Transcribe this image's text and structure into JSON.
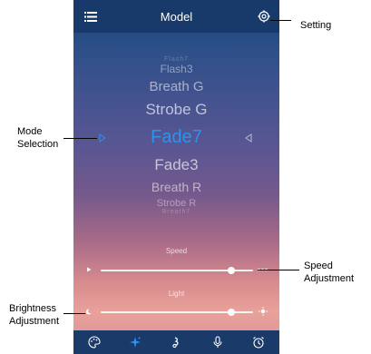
{
  "header": {
    "title": "Model"
  },
  "modes": {
    "items": [
      "Flash7",
      "Flash3",
      "Breath G",
      "Strobe G",
      "Fade7",
      "Fade3",
      "Breath R",
      "Strobe R",
      "Breath7"
    ],
    "selected": "Fade7"
  },
  "sliders": {
    "speed": {
      "label": "Speed",
      "value": 0.86
    },
    "light": {
      "label": "Light",
      "value": 0.86
    }
  },
  "tabs": [
    "palette-icon",
    "sparkle-icon",
    "music-icon",
    "mic-icon",
    "alarm-icon"
  ],
  "annotations": {
    "setting": "Setting",
    "mode_selection_1": "Mode",
    "mode_selection_2": "Selection",
    "speed_adjustment_1": "Speed",
    "speed_adjustment_2": "Adjustment",
    "brightness_adjustment_1": "Brightness",
    "brightness_adjustment_2": "Adjustment"
  },
  "colors": {
    "accent": "#2a93f0",
    "bar": "#173a6b"
  }
}
